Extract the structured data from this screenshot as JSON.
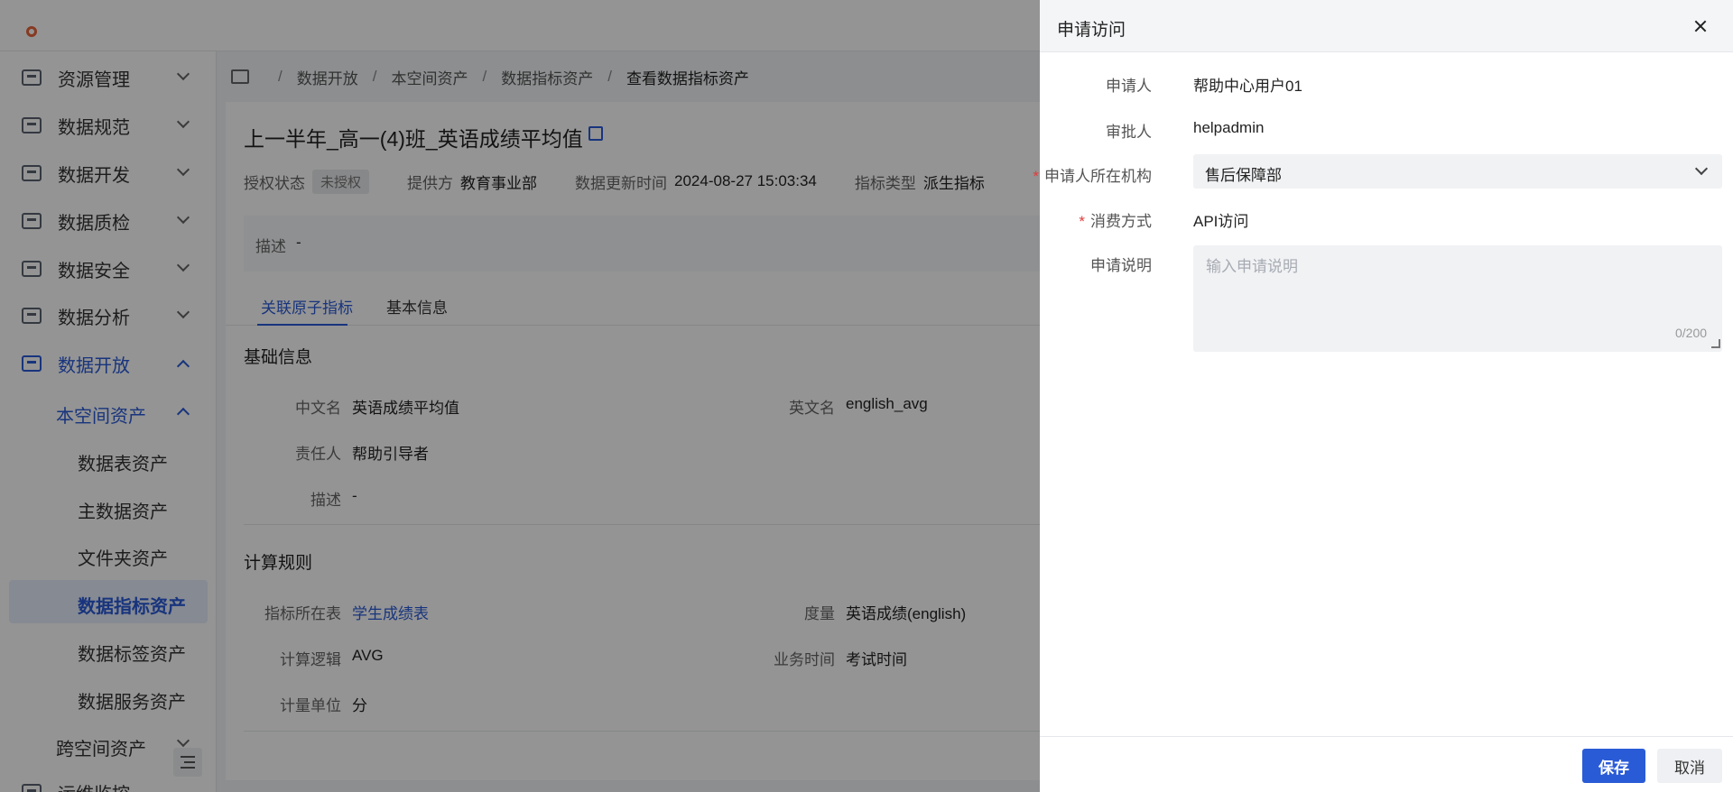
{
  "app": {
    "accent": "#2a5bd7"
  },
  "sidebar": {
    "items": [
      {
        "label": "资源管理",
        "icon": "resource-icon"
      },
      {
        "label": "数据规范",
        "icon": "standard-icon"
      },
      {
        "label": "数据开发",
        "icon": "develop-icon"
      },
      {
        "label": "数据质检",
        "icon": "quality-icon"
      },
      {
        "label": "数据安全",
        "icon": "security-icon"
      },
      {
        "label": "数据分析",
        "icon": "analysis-icon"
      },
      {
        "label": "数据开放",
        "icon": "open-icon"
      }
    ],
    "sub": {
      "label": "本空间资产"
    },
    "leaves": [
      "数据表资产",
      "主数据资产",
      "文件夹资产",
      "数据指标资产",
      "数据标签资产",
      "数据服务资产"
    ],
    "sub2": {
      "label": "跨空间资产"
    },
    "next_partial": "运维监控"
  },
  "breadcrumb": [
    "数据开放",
    "本空间资产",
    "数据指标资产",
    "查看数据指标资产"
  ],
  "asset": {
    "title": "上一半年_高一(4)班_英语成绩平均值",
    "meta": {
      "auth_label": "授权状态",
      "auth_value": "未授权",
      "provider_label": "提供方",
      "provider_value": "教育事业部",
      "update_label": "数据更新时间",
      "update_value": "2024-08-27 15:03:34",
      "type_label": "指标类型",
      "type_value": "派生指标"
    },
    "desc_label": "描述",
    "desc_value": "-",
    "tabs": [
      "关联原子指标",
      "基本信息"
    ],
    "basic_title": "基础信息",
    "basic": {
      "cn_label": "中文名",
      "cn_value": "英语成绩平均值",
      "en_label": "英文名",
      "en_value": "english_avg",
      "owner_label": "责任人",
      "owner_value": "帮助引导者",
      "desc_label": "描述",
      "desc_value": "-"
    },
    "calc_title": "计算规则",
    "calc": {
      "table_label": "指标所在表",
      "table_value": "学生成绩表",
      "measure_label": "度量",
      "measure_value": "英语成绩(english)",
      "logic_label": "计算逻辑",
      "logic_value": "AVG",
      "bizdate_label": "业务时间",
      "bizdate_value": "考试时间",
      "unit_label": "计量单位",
      "unit_value": "分"
    }
  },
  "drawer": {
    "title": "申请访问",
    "applicant_label": "申请人",
    "applicant_value": "帮助中心用户01",
    "approver_label": "审批人",
    "approver_value": "helpadmin",
    "org_label": "申请人所在机构",
    "org_value": "售后保障部",
    "consume_label": "消费方式",
    "consume_value": "API访问",
    "reason_label": "申请说明",
    "reason_placeholder": "输入申请说明",
    "reason_value": "",
    "counter": "0/200",
    "save_label": "保存",
    "cancel_label": "取消",
    "required_mark": "*"
  }
}
